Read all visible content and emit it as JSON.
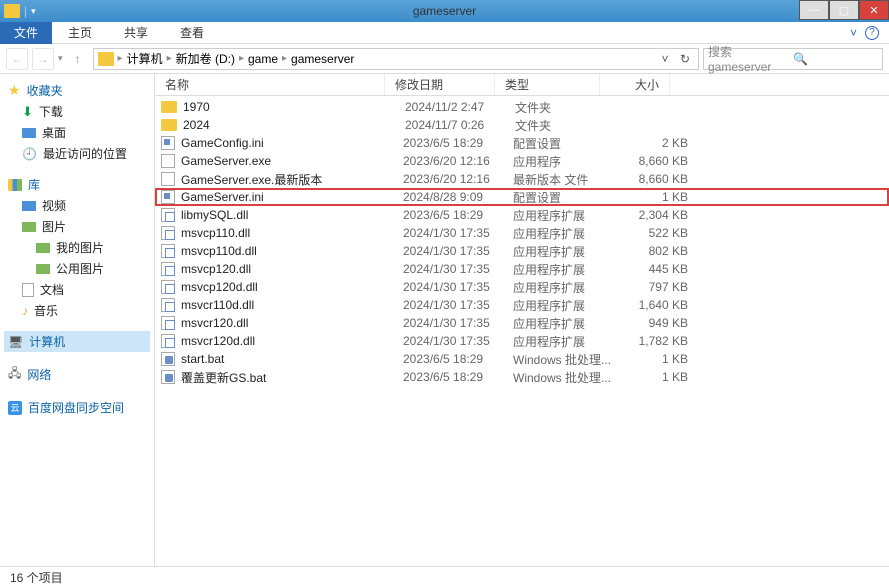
{
  "title": "gameserver",
  "ribbon": {
    "file": "文件",
    "tabs": [
      "主页",
      "共享",
      "查看"
    ]
  },
  "address": {
    "crumbs": [
      "计算机",
      "新加卷 (D:)",
      "game",
      "gameserver"
    ]
  },
  "search": {
    "placeholder": "搜索 gameserver"
  },
  "sidebar": {
    "fav": {
      "head": "收藏夹",
      "items": [
        "下载",
        "桌面",
        "最近访问的位置"
      ]
    },
    "lib": {
      "head": "库",
      "items": [
        "视频",
        "图片",
        "我的图片",
        "公用图片",
        "文档",
        "音乐"
      ]
    },
    "computer": "计算机",
    "network": "网络",
    "baidu": "百度网盘同步空间"
  },
  "cols": {
    "name": "名称",
    "date": "修改日期",
    "type": "类型",
    "size": "大小"
  },
  "files": [
    {
      "icon": "folder",
      "name": "1970",
      "date": "2024/11/2 2:47",
      "type": "文件夹",
      "size": ""
    },
    {
      "icon": "folder",
      "name": "2024",
      "date": "2024/11/7 0:26",
      "type": "文件夹",
      "size": ""
    },
    {
      "icon": "ini",
      "name": "GameConfig.ini",
      "date": "2023/6/5 18:29",
      "type": "配置设置",
      "size": "2 KB"
    },
    {
      "icon": "exe",
      "name": "GameServer.exe",
      "date": "2023/6/20 12:16",
      "type": "应用程序",
      "size": "8,660 KB"
    },
    {
      "icon": "exe",
      "name": "GameServer.exe.最新版本",
      "date": "2023/6/20 12:16",
      "type": "最新版本 文件",
      "size": "8,660 KB"
    },
    {
      "icon": "ini",
      "name": "GameServer.ini",
      "date": "2024/8/28 9:09",
      "type": "配置设置",
      "size": "1 KB",
      "hl": true
    },
    {
      "icon": "dll",
      "name": "libmySQL.dll",
      "date": "2023/6/5 18:29",
      "type": "应用程序扩展",
      "size": "2,304 KB"
    },
    {
      "icon": "dll",
      "name": "msvcp110.dll",
      "date": "2024/1/30 17:35",
      "type": "应用程序扩展",
      "size": "522 KB"
    },
    {
      "icon": "dll",
      "name": "msvcp110d.dll",
      "date": "2024/1/30 17:35",
      "type": "应用程序扩展",
      "size": "802 KB"
    },
    {
      "icon": "dll",
      "name": "msvcp120.dll",
      "date": "2024/1/30 17:35",
      "type": "应用程序扩展",
      "size": "445 KB"
    },
    {
      "icon": "dll",
      "name": "msvcp120d.dll",
      "date": "2024/1/30 17:35",
      "type": "应用程序扩展",
      "size": "797 KB"
    },
    {
      "icon": "dll",
      "name": "msvcr110d.dll",
      "date": "2024/1/30 17:35",
      "type": "应用程序扩展",
      "size": "1,640 KB"
    },
    {
      "icon": "dll",
      "name": "msvcr120.dll",
      "date": "2024/1/30 17:35",
      "type": "应用程序扩展",
      "size": "949 KB"
    },
    {
      "icon": "dll",
      "name": "msvcr120d.dll",
      "date": "2024/1/30 17:35",
      "type": "应用程序扩展",
      "size": "1,782 KB"
    },
    {
      "icon": "bat",
      "name": "start.bat",
      "date": "2023/6/5 18:29",
      "type": "Windows 批处理...",
      "size": "1 KB"
    },
    {
      "icon": "bat",
      "name": "覆盖更新GS.bat",
      "date": "2023/6/5 18:29",
      "type": "Windows 批处理...",
      "size": "1 KB"
    }
  ],
  "status": "16 个项目"
}
